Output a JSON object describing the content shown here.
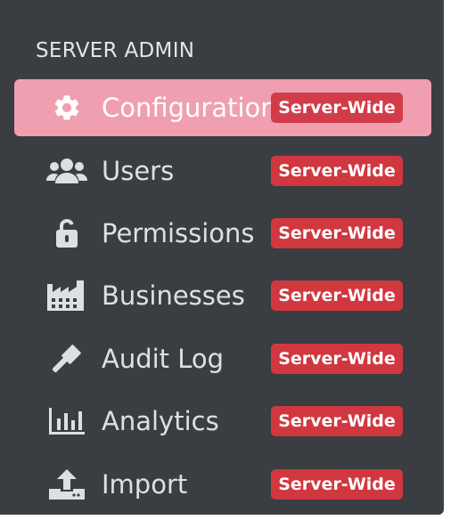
{
  "section": {
    "title": "SERVER ADMIN"
  },
  "nav": {
    "items": [
      {
        "label": "Configuration",
        "badge": "Server-Wide",
        "icon": "gear-icon",
        "active": true
      },
      {
        "label": "Users",
        "badge": "Server-Wide",
        "icon": "users-icon",
        "active": false
      },
      {
        "label": "Permissions",
        "badge": "Server-Wide",
        "icon": "unlock-icon",
        "active": false
      },
      {
        "label": "Businesses",
        "badge": "Server-Wide",
        "icon": "industry-icon",
        "active": false
      },
      {
        "label": "Audit Log",
        "badge": "Server-Wide",
        "icon": "gavel-icon",
        "active": false
      },
      {
        "label": "Analytics",
        "badge": "Server-Wide",
        "icon": "bar-chart-icon",
        "active": false
      },
      {
        "label": "Import",
        "badge": "Server-Wide",
        "icon": "upload-icon",
        "active": false
      }
    ]
  },
  "colors": {
    "sidebar_bg": "#3a3d42",
    "active_bg": "#ef9fb0",
    "badge_bg": "#d1373f",
    "text": "#dde0e4"
  }
}
